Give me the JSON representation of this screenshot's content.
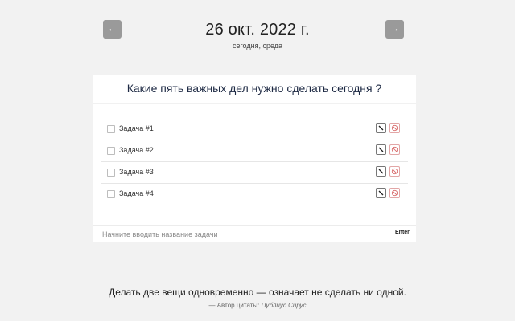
{
  "header": {
    "prev_label": "←",
    "next_label": "→",
    "date": "26 окт. 2022 г.",
    "subtitle": "сегодня, среда"
  },
  "card": {
    "title": "Какие пять важных дел нужно сделать сегодня ?",
    "tasks": [
      {
        "label": "Задача #1",
        "done": false
      },
      {
        "label": "Задача #2",
        "done": false
      },
      {
        "label": "Задача #3",
        "done": false
      },
      {
        "label": "Задача #4",
        "done": false
      }
    ],
    "input": {
      "placeholder": "Начните вводить название задачи",
      "value": ""
    },
    "enter_label": "Enter"
  },
  "quote": {
    "text": "Делать две вещи одновременно — означает не сделать ни одной.",
    "author_prefix": "— Автор цитаты:",
    "author_name": "Публиус Сирус"
  },
  "colors": {
    "background": "#f2f2f2",
    "nav_button": "#9a9a9a",
    "title_text": "#1e2a44",
    "delete_accent": "#d96b6b"
  },
  "icons": {
    "edit": "pencil-icon",
    "delete": "forbidden-icon",
    "prev": "arrow-left-icon",
    "next": "arrow-right-icon"
  }
}
